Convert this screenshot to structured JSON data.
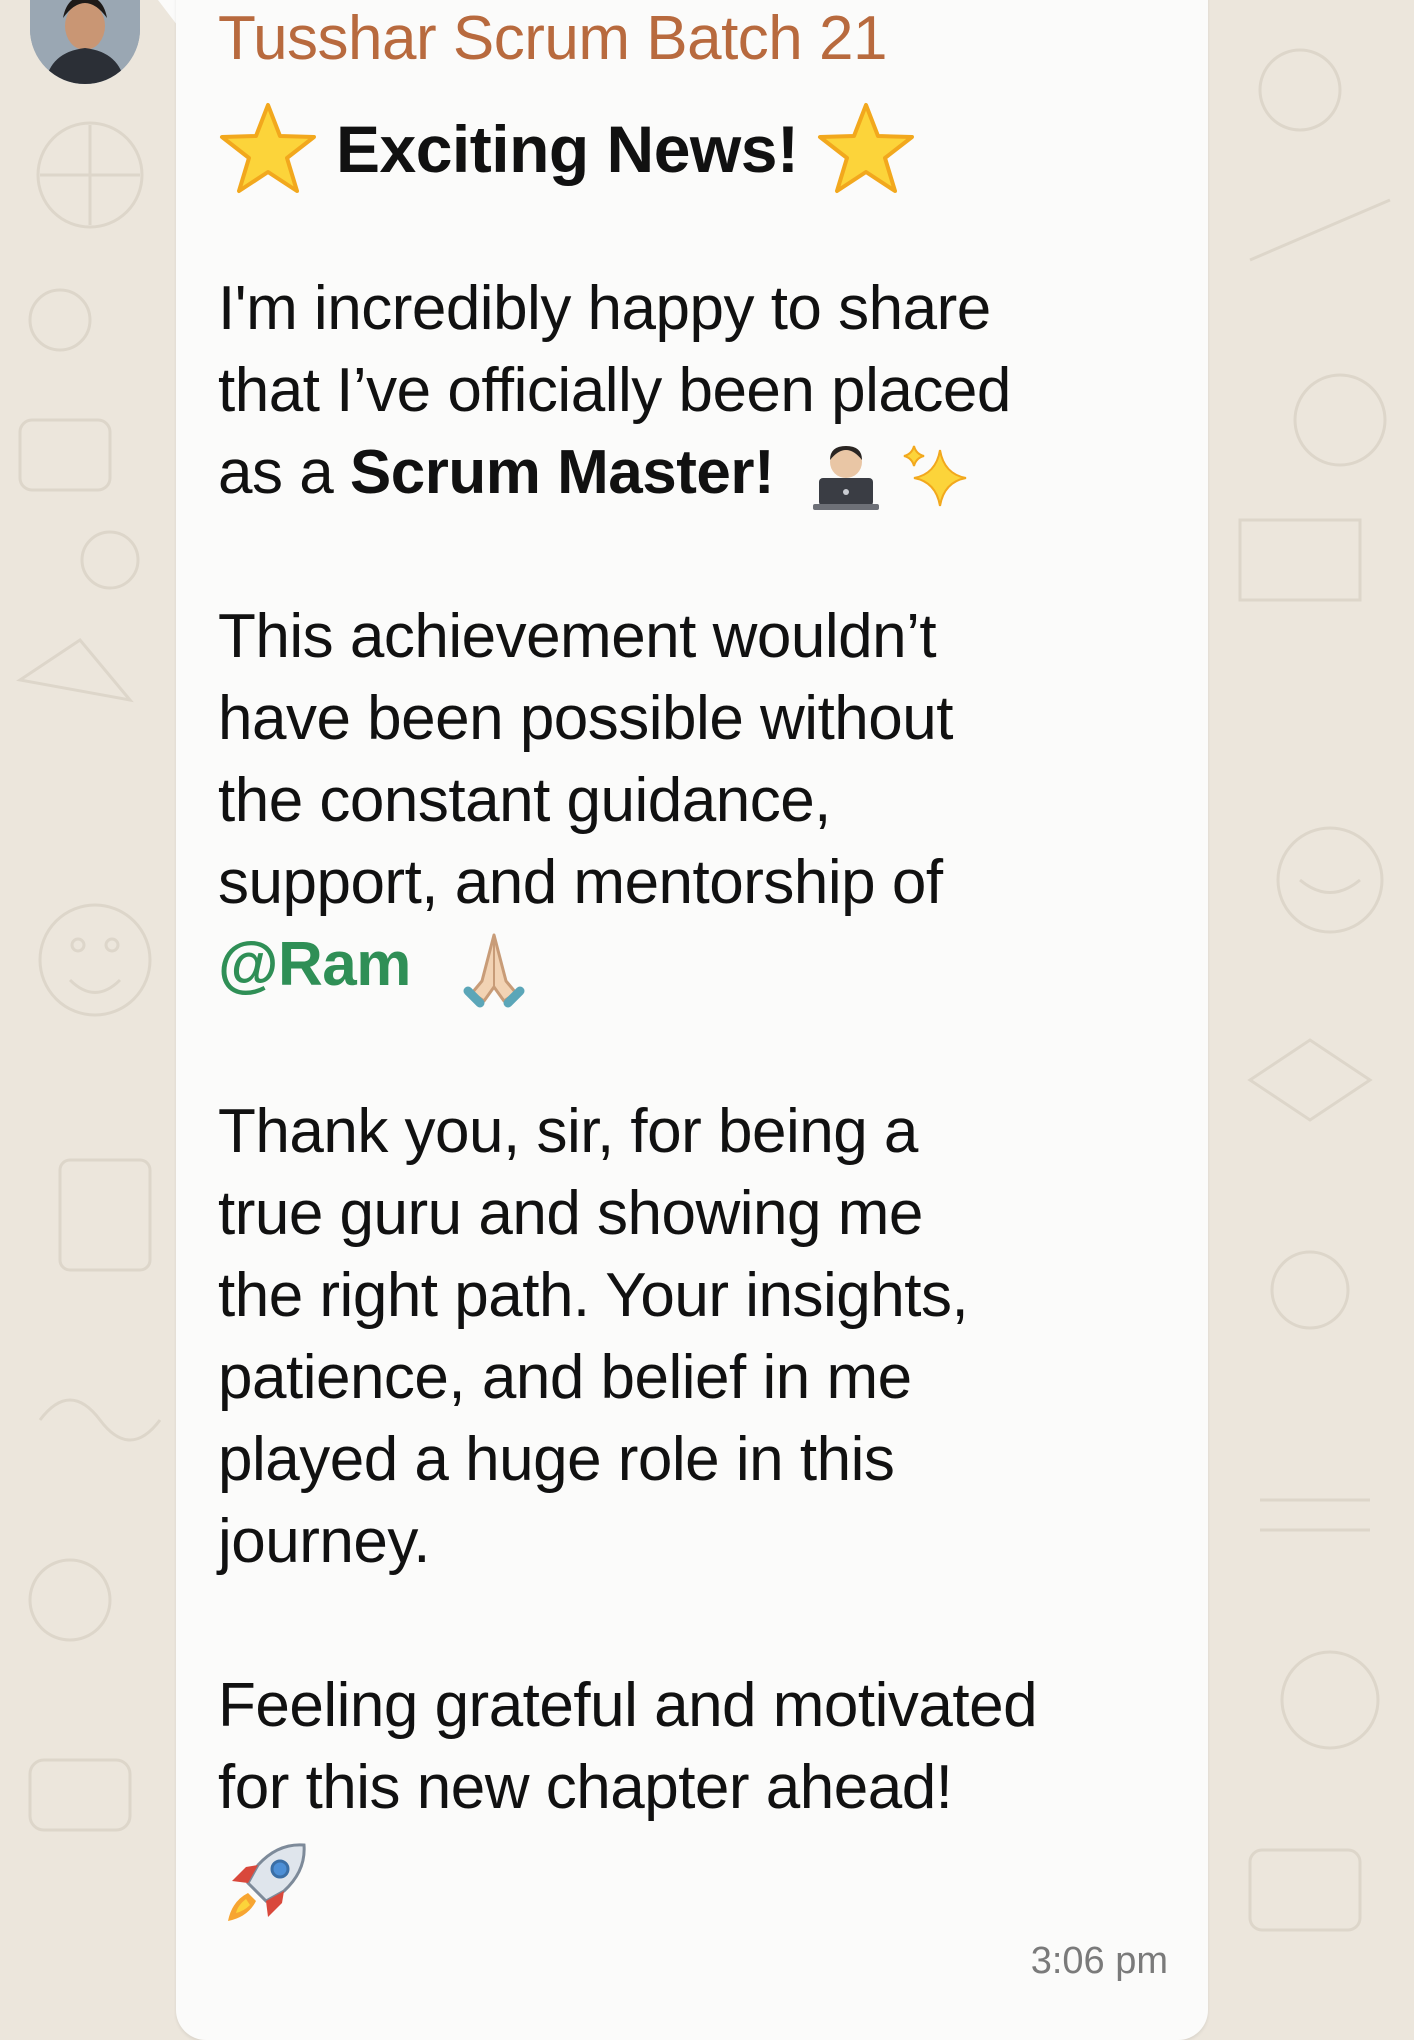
{
  "message": {
    "sender_name": "Tusshar Scrum Batch 21",
    "headline": "Exciting News!",
    "para1_line1": "I'm incredibly happy to share",
    "para1_line2": "that I’ve officially been placed",
    "para1_line3_prefix": "as a ",
    "para1_line3_bold": "Scrum Master!",
    "para2_line1": "This achievement wouldn’t",
    "para2_line2": "have been possible without",
    "para2_line3": "the constant guidance,",
    "para2_line4": "support, and mentorship of",
    "mention": "@Ram",
    "para3_line1": "Thank you, sir, for being a",
    "para3_line2": "true guru and showing me",
    "para3_line3": "the right path. Your insights,",
    "para3_line4": "patience, and belief in me",
    "para3_line5": "played a huge role in this",
    "para3_line6": "journey.",
    "para4_line1": "Feeling grateful and motivated",
    "para4_line2": "for this new chapter ahead!",
    "timestamp": "3:06 pm"
  },
  "icons": {
    "avatar": "avatar-photo",
    "headline_left": "star-emoji",
    "headline_right": "star-emoji",
    "scrum_master": "technologist-emoji",
    "sparkles": "sparkles-emoji",
    "thanks": "folded-hands-emoji",
    "launch": "rocket-emoji"
  },
  "colors": {
    "sender": "#b86a3e",
    "mention": "#2f8f56",
    "bubble": "#fbfbfa",
    "wallpaper": "#ece6dc",
    "text": "#111111"
  }
}
